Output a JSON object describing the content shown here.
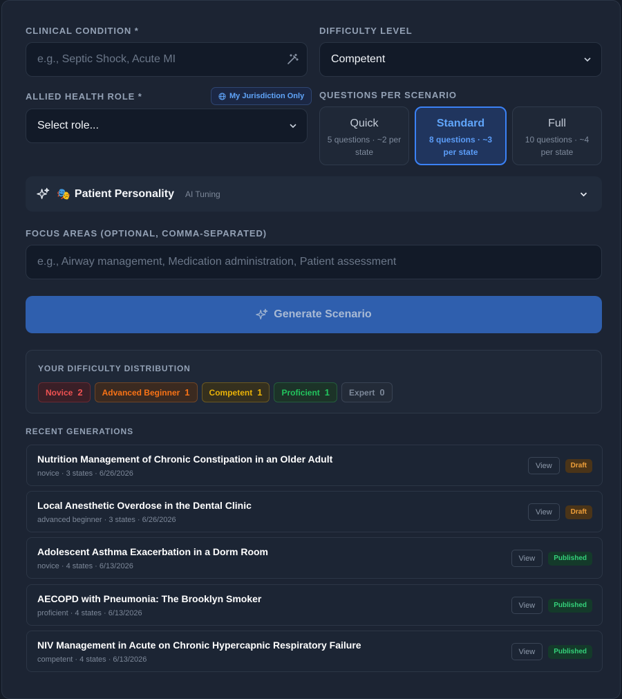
{
  "form": {
    "condition": {
      "label": "CLINICAL CONDITION *",
      "placeholder": "e.g., Septic Shock, Acute MI"
    },
    "difficulty": {
      "label": "DIFFICULTY LEVEL",
      "value": "Competent"
    },
    "role": {
      "label": "ALLIED HEALTH ROLE *",
      "value": "Select role...",
      "jurisdiction_label": "My Jurisdiction Only"
    },
    "questions": {
      "label": "QUESTIONS PER SCENARIO",
      "options": [
        {
          "title": "Quick",
          "sub": "5 questions · ~2 per state",
          "active": false
        },
        {
          "title": "Standard",
          "sub": "8 questions · ~3 per state",
          "active": true
        },
        {
          "title": "Full",
          "sub": "10 questions · ~4 per state",
          "active": false
        }
      ]
    },
    "personality": {
      "emoji": "🎭",
      "title": "Patient Personality",
      "tag": "AI Tuning"
    },
    "focus": {
      "label": "FOCUS AREAS (OPTIONAL, COMMA-SEPARATED)",
      "placeholder": "e.g., Airway management, Medication administration, Patient assessment"
    },
    "generate_label": "Generate Scenario"
  },
  "distribution": {
    "label": "YOUR DIFFICULTY DISTRIBUTION",
    "items": [
      {
        "name": "Novice",
        "count": "2"
      },
      {
        "name": "Advanced Beginner",
        "count": "1"
      },
      {
        "name": "Competent",
        "count": "1"
      },
      {
        "name": "Proficient",
        "count": "1"
      },
      {
        "name": "Expert",
        "count": "0"
      }
    ]
  },
  "recent": {
    "label": "RECENT GENERATIONS",
    "view_label": "View",
    "items": [
      {
        "title": "Nutrition Management of Chronic Constipation in an Older Adult",
        "meta": "novice · 3 states · 6/26/2026",
        "status": "Draft"
      },
      {
        "title": "Local Anesthetic Overdose in the Dental Clinic",
        "meta": "advanced beginner · 3 states · 6/26/2026",
        "status": "Draft"
      },
      {
        "title": "Adolescent Asthma Exacerbation in a Dorm Room",
        "meta": "novice · 4 states · 6/13/2026",
        "status": "Published"
      },
      {
        "title": "AECOPD with Pneumonia: The Brooklyn Smoker",
        "meta": "proficient · 4 states · 6/13/2026",
        "status": "Published"
      },
      {
        "title": "NIV Management in Acute on Chronic Hypercapnic Respiratory Failure",
        "meta": "competent · 4 states · 6/13/2026",
        "status": "Published"
      }
    ]
  },
  "colors": {
    "accent": "#3b82f6",
    "novice": "#ef4444",
    "advanced_beginner": "#f97316",
    "competent": "#eab308",
    "proficient": "#22c55e",
    "expert": "#6b7280"
  }
}
